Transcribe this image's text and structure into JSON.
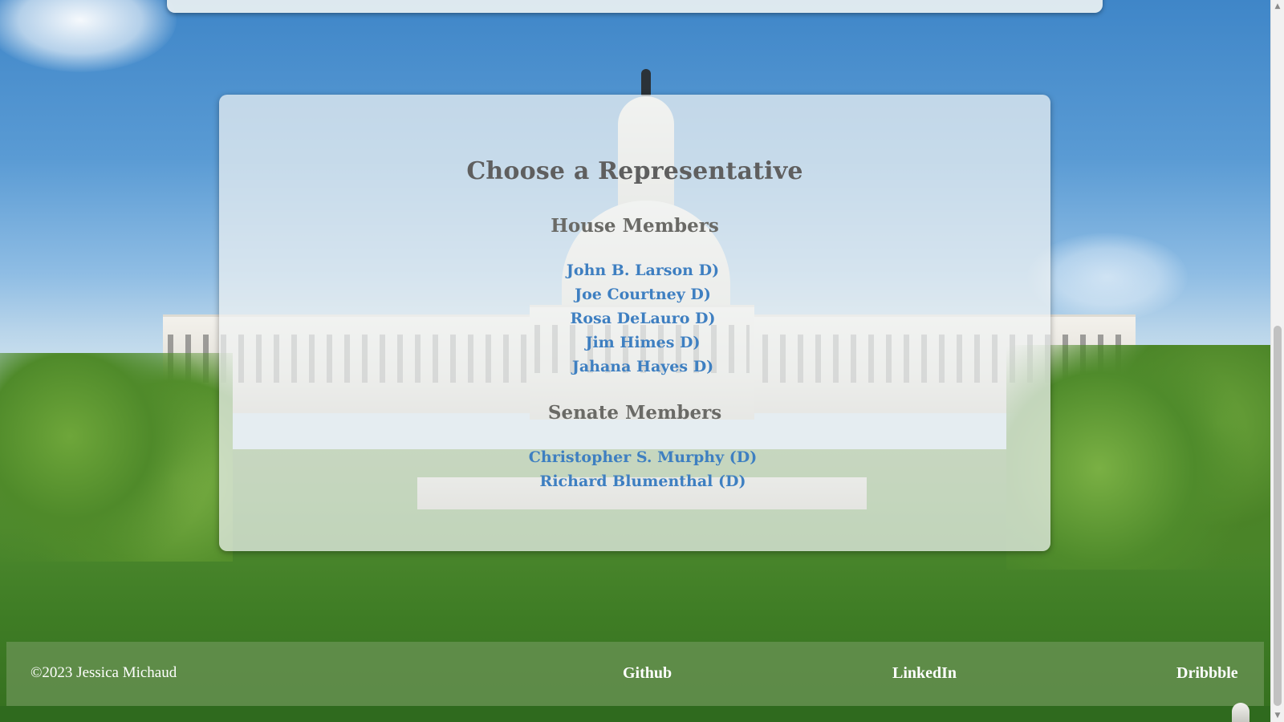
{
  "page": {
    "title": "Choose a Representative"
  },
  "house": {
    "heading": "House Members",
    "members": [
      "John B. Larson D)",
      "Joe Courtney D)",
      "Rosa DeLauro D)",
      "Jim Himes D)",
      "Jahana Hayes D)"
    ]
  },
  "senate": {
    "heading": "Senate Members",
    "members": [
      "Christopher S. Murphy (D)",
      "Richard Blumenthal (D)"
    ]
  },
  "footer": {
    "copyright": "©2023 Jessica Michaud",
    "links": {
      "github": "Github",
      "linkedin": "LinkedIn",
      "dribbble": "Dribbble"
    }
  },
  "icons": {
    "scroll_up": "triangle-up",
    "scroll_down": "triangle-down",
    "corner": "capitol-dome"
  },
  "colors": {
    "link": "#3e7fc1",
    "heading": "#5f5f5f",
    "footer_text": "#ffffff"
  }
}
